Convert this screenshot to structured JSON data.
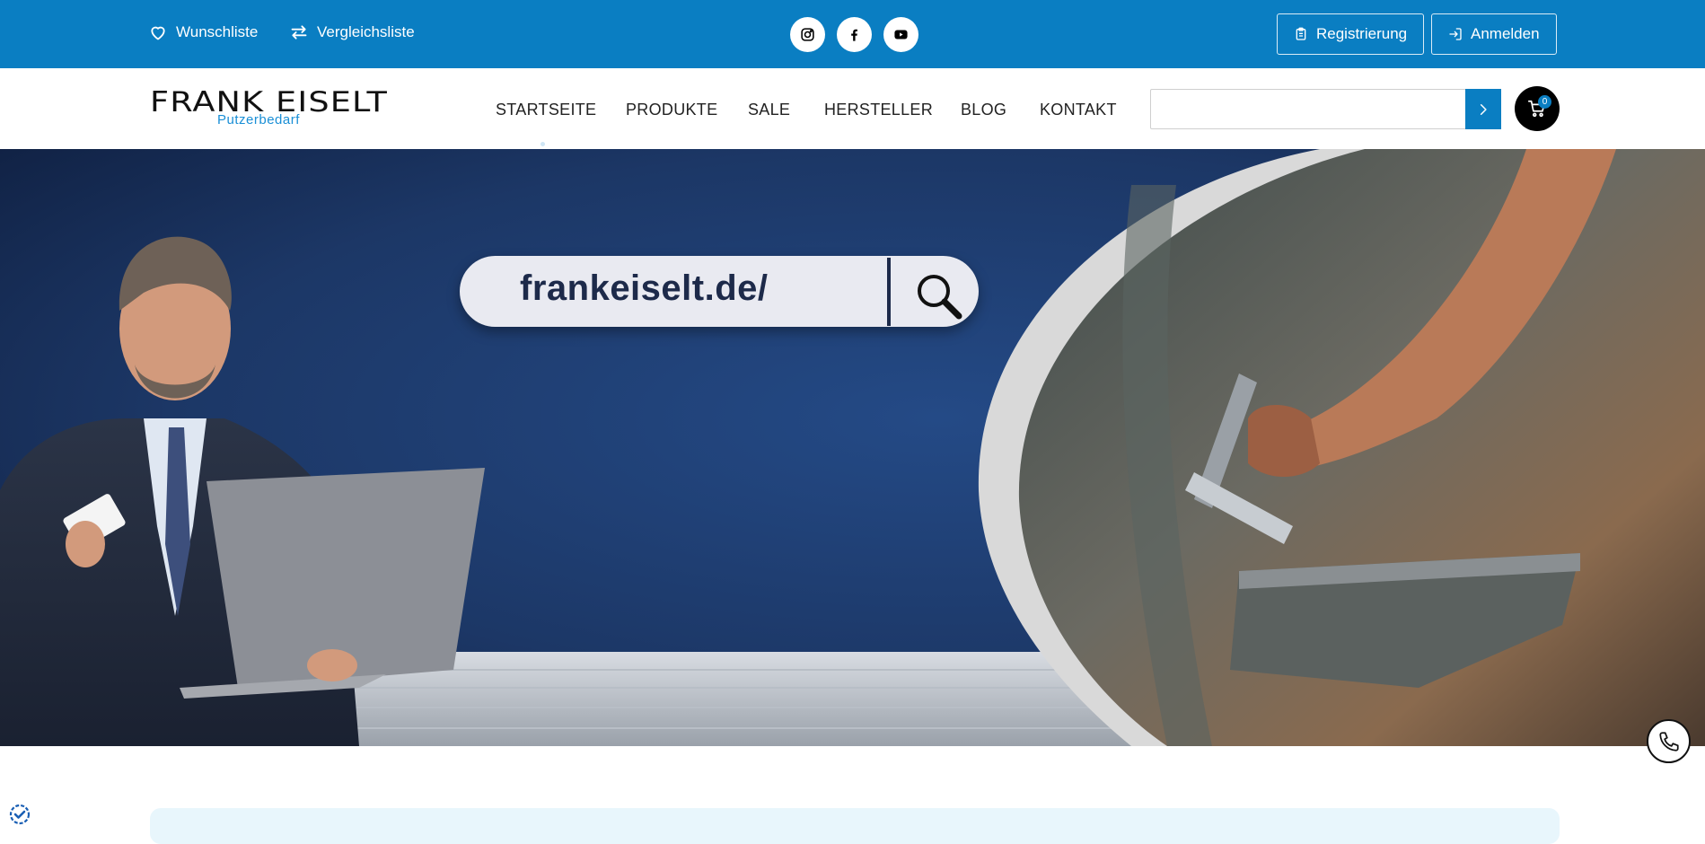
{
  "topbar": {
    "wishlist_label": "Wunschliste",
    "compare_label": "Vergleichsliste",
    "social": [
      "instagram-icon",
      "facebook-icon",
      "youtube-icon"
    ],
    "register_label": "Registrierung",
    "login_label": "Anmelden",
    "background_color": "#0a7ec2"
  },
  "header": {
    "logo_title": "FRANK EISELT",
    "logo_subtitle": "Putzerbedarf",
    "nav": [
      "STARTSEITE",
      "PRODUKTE",
      "SALE",
      "HERSTELLER",
      "BLOG",
      "KONTAKT"
    ],
    "search_placeholder": "",
    "search_value": "",
    "cart_count": "0"
  },
  "hero": {
    "search_text": "frankeiselt.de/"
  },
  "colors": {
    "accent": "#0a7ec2",
    "hero_blue": "#1c3766",
    "text_dark": "#222222"
  }
}
